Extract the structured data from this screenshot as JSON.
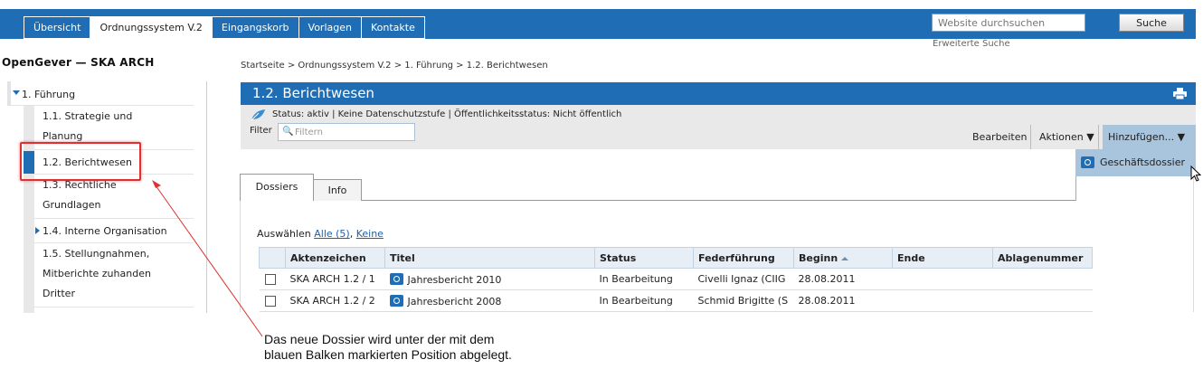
{
  "nav": {
    "tabs": [
      {
        "label": "Übersicht"
      },
      {
        "label": "Ordnungssystem V.2"
      },
      {
        "label": "Eingangskorb"
      },
      {
        "label": "Vorlagen"
      },
      {
        "label": "Kontakte"
      }
    ],
    "active_tab": "Ordnungssystem V.2",
    "search_placeholder": "Website durchsuchen",
    "search_button": "Suche",
    "advanced_search": "Erweiterte Suche"
  },
  "site_title": "OpenGever — SKA ARCH",
  "sidebar": {
    "root": "1. Führung",
    "items": [
      {
        "label": "1.1. Strategie und Planung"
      },
      {
        "label": "1.2. Berichtwesen",
        "active": true
      },
      {
        "label": "1.3. Rechtliche Grundlagen"
      },
      {
        "label": "1.4. Interne Organisation",
        "expandable": true
      },
      {
        "label": "1.5. Stellungnahmen, Mitberichte zuhanden Dritter"
      }
    ]
  },
  "breadcrumb": "Startseite > Ordnungssystem V.2 > 1. Führung > 1.2. Berichtwesen",
  "page_title": "1.2. Berichtwesen",
  "status_line": "Status: aktiv | Keine Datenschutzstufe | Öffentlichkeitsstatus: Nicht öffentlich",
  "filter": {
    "label": "Filter",
    "placeholder": "Filtern"
  },
  "actions": {
    "edit": "Bearbeiten",
    "actions": "Aktionen ▼",
    "add": "Hinzufügen... ▼",
    "add_menu_item": "Geschäftsdossier"
  },
  "tabs": [
    {
      "label": "Dossiers",
      "active": true
    },
    {
      "label": "Info"
    }
  ],
  "select": {
    "prefix": "Auswählen",
    "all": "Alle (5)",
    "separator": ",",
    "none": "Keine"
  },
  "table": {
    "columns": [
      "Aktenzeichen",
      "Titel",
      "Status",
      "Federführung",
      "Beginn",
      "Ende",
      "Ablagenummer"
    ],
    "sorted_column": "Beginn",
    "rows": [
      {
        "aktenzeichen": "SKA ARCH 1.2 / 1",
        "titel": "Jahresbericht 2010",
        "status": "In Bearbeitung",
        "federfuehrung": "Civelli Ignaz (CIIG",
        "beginn": "28.08.2011",
        "ende": "",
        "ablagenummer": ""
      },
      {
        "aktenzeichen": "SKA ARCH 1.2 / 2",
        "titel": "Jahresbericht 2008",
        "status": "In Bearbeitung",
        "federfuehrung": "Schmid Brigitte (S",
        "beginn": "28.08.2011",
        "ende": "",
        "ablagenummer": ""
      }
    ]
  },
  "annotation": {
    "line1": "Das neue Dossier wird unter der mit dem",
    "line2": "blauen Balken markierten Position abgelegt."
  },
  "colors": {
    "brand_blue": "#1f6db4",
    "highlight_red": "#e03030",
    "menu_blue": "#a9c4dd"
  }
}
